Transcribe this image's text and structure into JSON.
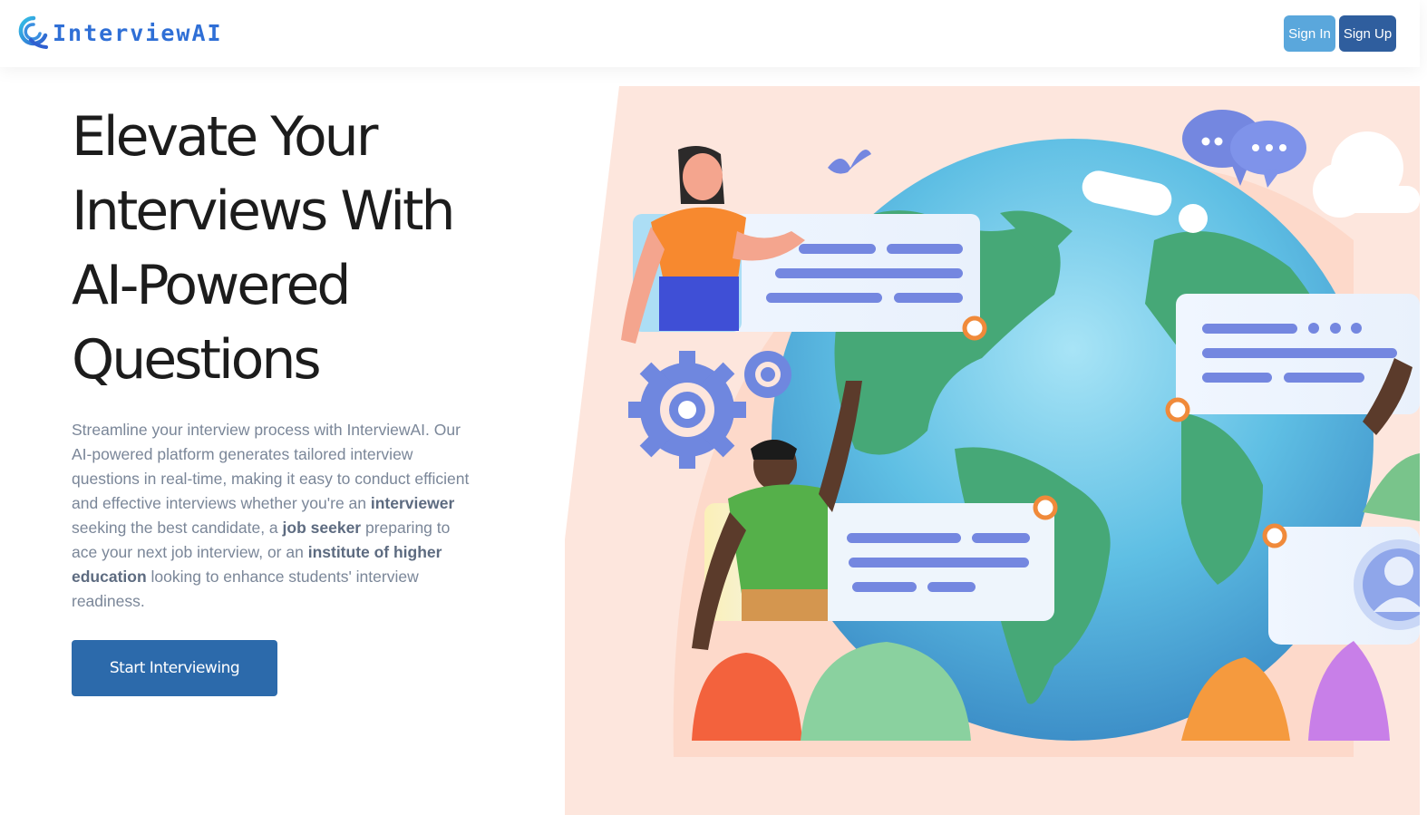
{
  "navbar": {
    "brand": "InterviewAI",
    "sign_in_label": "Sign In",
    "sign_up_label": "Sign Up",
    "colors": {
      "brand": "#2f6fd6",
      "sign_in": "#5aa7dc",
      "sign_up": "#2f5e9e"
    }
  },
  "hero": {
    "title_lines": [
      "Elevate Your",
      "Interviews With",
      "AI-Powered",
      "Questions"
    ],
    "description": {
      "part1": "Streamline your interview process with InterviewAI. Our AI-powered platform generates tailored interview questions in real-time, making it easy to conduct efficient and effective interviews whether you're an ",
      "highlight1": "interviewer",
      "part2": " seeking the best candidate, a ",
      "highlight2": "job seeker",
      "part3": " preparing to ace your next job interview, or an ",
      "highlight3": "institute of higher education",
      "part4": " looking to enhance students' interview readiness."
    },
    "cta_label": "Start Interviewing",
    "cta_color": "#2c6aab"
  },
  "illustration": {
    "icons": [
      "globe-icon",
      "chat-bubbles-icon",
      "bird-icon",
      "gear-icon",
      "avatar-icon",
      "cloud-icon"
    ]
  }
}
